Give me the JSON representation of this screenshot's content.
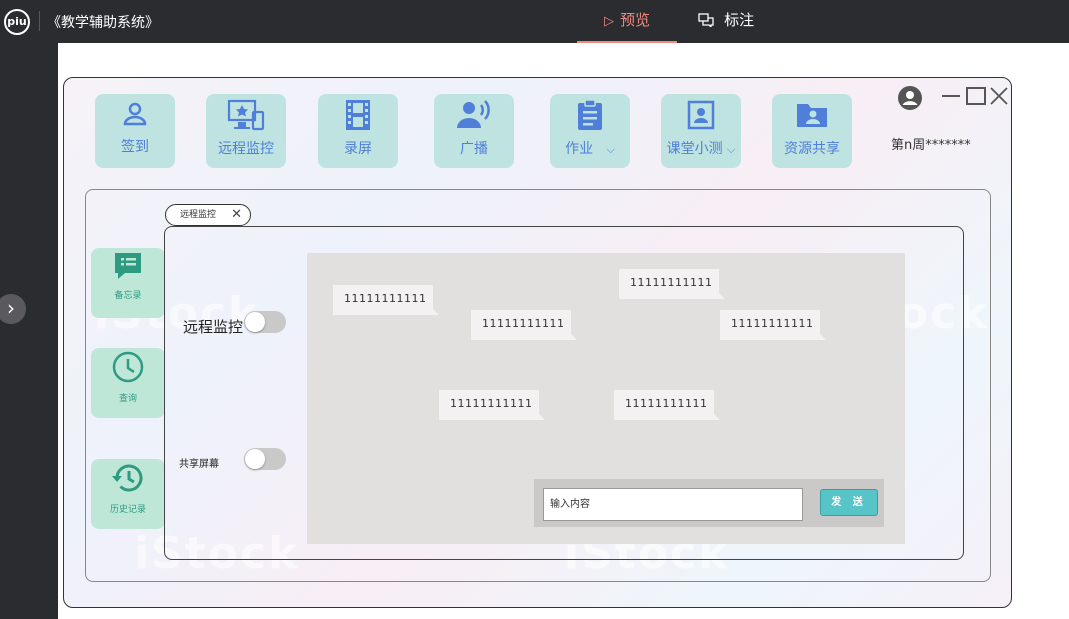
{
  "app": {
    "logo": "piu",
    "title": "《教学辅助系统》"
  },
  "tabs": {
    "preview": "预览",
    "annotate": "标注"
  },
  "toolbar": [
    {
      "label": "签到",
      "icon": "user-icon"
    },
    {
      "label": "远程监控",
      "icon": "monitor-star-icon"
    },
    {
      "label": "录屏",
      "icon": "film-icon"
    },
    {
      "label": "广播",
      "icon": "broadcast-icon"
    },
    {
      "label": "作业",
      "icon": "clipboard-icon",
      "dropdown": "⌵"
    },
    {
      "label": "课堂小测",
      "icon": "portrait-icon",
      "dropdown": "⌵"
    },
    {
      "label": "资源共享",
      "icon": "folder-user-icon"
    }
  ],
  "user": {
    "week_text": "第n周*******"
  },
  "open_tab": {
    "label": "远程监控",
    "close": "✕"
  },
  "sidebar": [
    {
      "label": "备忘录",
      "icon": "memo-icon"
    },
    {
      "label": "查询",
      "icon": "clock-icon"
    },
    {
      "label": "历史记录",
      "icon": "history-icon"
    }
  ],
  "controls": {
    "remote_monitor_label": "远程监控",
    "share_screen_label": "共享屏幕",
    "remote_monitor_on": false,
    "share_screen_on": false
  },
  "messages": [
    "11111111111",
    "11111111111",
    "11111111111",
    "11111111111",
    "11111111111",
    "11111111111"
  ],
  "composer": {
    "placeholder": "输入内容",
    "send_label": "发 送"
  },
  "watermark": "iStock",
  "colors": {
    "accent": "#f08a80",
    "tool_bg": "#bfe3e0",
    "tool_fg": "#4f7fd8",
    "side_bg": "#bfe7d8",
    "side_fg": "#2f9a82",
    "send_bg": "#57c4c7"
  }
}
